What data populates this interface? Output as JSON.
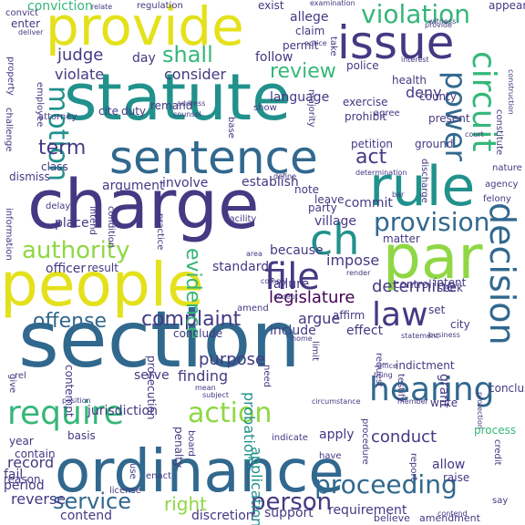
{
  "palette": {
    "yellow": "#e4e11b",
    "lime": "#8fd744",
    "green": "#35b779",
    "teal": "#21918c",
    "blue": "#31688e",
    "indigo": "#443983",
    "purple": "#440154"
  },
  "words": [
    {
      "text": "statute",
      "color": "teal"
    },
    {
      "text": "section",
      "color": "blue"
    },
    {
      "text": "charge",
      "color": "indigo"
    },
    {
      "text": "ordinance",
      "color": "blue"
    },
    {
      "text": "people",
      "color": "yellow"
    },
    {
      "text": "par",
      "color": "lime"
    },
    {
      "text": "provide",
      "color": "yellow"
    },
    {
      "text": "rule",
      "color": "teal"
    },
    {
      "text": "sentence",
      "color": "blue"
    },
    {
      "text": "issue",
      "color": "indigo"
    },
    {
      "text": "ch",
      "color": "teal"
    },
    {
      "text": "file",
      "color": "indigo"
    },
    {
      "text": "law",
      "color": "indigo"
    },
    {
      "text": "decision",
      "color": "blue"
    },
    {
      "text": "circuit",
      "color": "green"
    },
    {
      "text": "power",
      "color": "blue"
    },
    {
      "text": "hearing",
      "color": "blue"
    },
    {
      "text": "require",
      "color": "green"
    },
    {
      "text": "action",
      "color": "lime"
    },
    {
      "text": "provision",
      "color": "blue"
    },
    {
      "text": "authority",
      "color": "lime"
    },
    {
      "text": "violation",
      "color": "green"
    },
    {
      "text": "motion",
      "color": "teal"
    },
    {
      "text": "proceeding",
      "color": "blue"
    },
    {
      "text": "service",
      "color": "blue"
    },
    {
      "text": "person",
      "color": "indigo"
    },
    {
      "text": "offense",
      "color": "blue"
    },
    {
      "text": "complaint",
      "color": "indigo"
    },
    {
      "text": "evidence",
      "color": "green"
    },
    {
      "text": "legislature",
      "color": "purple"
    },
    {
      "text": "review",
      "color": "green"
    },
    {
      "text": "term",
      "color": "indigo"
    },
    {
      "text": "act",
      "color": "indigo"
    },
    {
      "text": "shall",
      "color": "green"
    },
    {
      "text": "judge",
      "color": "indigo"
    },
    {
      "text": "violate",
      "color": "indigo"
    },
    {
      "text": "consider",
      "color": "indigo"
    },
    {
      "text": "right",
      "color": "lime"
    },
    {
      "text": "conduct",
      "color": "indigo"
    },
    {
      "text": "determine",
      "color": "indigo"
    },
    {
      "text": "purpose",
      "color": "indigo"
    },
    {
      "text": "finding",
      "color": "indigo"
    },
    {
      "text": "jurisdiction",
      "color": "indigo"
    },
    {
      "text": "probation",
      "color": "teal"
    },
    {
      "text": "application",
      "color": "teal"
    },
    {
      "text": "failure",
      "color": "indigo"
    },
    {
      "text": "impose",
      "color": "indigo"
    },
    {
      "text": "argue",
      "color": "indigo"
    },
    {
      "text": "record",
      "color": "indigo"
    },
    {
      "text": "reverse",
      "color": "indigo"
    },
    {
      "text": "discretion",
      "color": "indigo"
    },
    {
      "text": "contend",
      "color": "indigo"
    },
    {
      "text": "support",
      "color": "indigo"
    },
    {
      "text": "requirement",
      "color": "indigo"
    },
    {
      "text": "believe",
      "color": "indigo"
    },
    {
      "text": "amendment",
      "color": "indigo"
    },
    {
      "text": "deny",
      "color": "indigo"
    },
    {
      "text": "standard",
      "color": "indigo"
    },
    {
      "text": "argument",
      "color": "indigo"
    },
    {
      "text": "place",
      "color": "indigo"
    },
    {
      "text": "officer",
      "color": "indigo"
    },
    {
      "text": "result",
      "color": "indigo"
    },
    {
      "text": "allege",
      "color": "indigo"
    },
    {
      "text": "claim",
      "color": "indigo"
    },
    {
      "text": "permit",
      "color": "indigo"
    },
    {
      "text": "enter",
      "color": "indigo"
    },
    {
      "text": "conviction",
      "color": "green"
    },
    {
      "text": "regulation",
      "color": "indigo"
    },
    {
      "text": "county",
      "color": "indigo"
    },
    {
      "text": "city",
      "color": "indigo"
    },
    {
      "text": "seek",
      "color": "indigo"
    },
    {
      "text": "matter",
      "color": "indigo"
    },
    {
      "text": "process",
      "color": "green"
    },
    {
      "text": "year",
      "color": "indigo"
    },
    {
      "text": "contain",
      "color": "indigo"
    },
    {
      "text": "fail",
      "color": "indigo"
    },
    {
      "text": "period",
      "color": "indigo"
    },
    {
      "text": "allow",
      "color": "indigo"
    },
    {
      "text": "raise",
      "color": "indigo"
    },
    {
      "text": "affirm",
      "color": "indigo"
    },
    {
      "text": "include",
      "color": "indigo"
    },
    {
      "text": "effect",
      "color": "indigo"
    },
    {
      "text": "conclude",
      "color": "indigo"
    },
    {
      "text": "serve",
      "color": "indigo"
    },
    {
      "text": "follow",
      "color": "indigo"
    },
    {
      "text": "exist",
      "color": "indigo"
    },
    {
      "text": "take",
      "color": "indigo"
    },
    {
      "text": "day",
      "color": "indigo"
    },
    {
      "text": "duty",
      "color": "indigo"
    },
    {
      "text": "cite",
      "color": "indigo"
    },
    {
      "text": "establish",
      "color": "indigo"
    },
    {
      "text": "involve",
      "color": "indigo"
    },
    {
      "text": "class",
      "color": "indigo"
    },
    {
      "text": "dismiss",
      "color": "indigo"
    },
    {
      "text": "note",
      "color": "indigo"
    },
    {
      "text": "leave",
      "color": "indigo"
    },
    {
      "text": "party",
      "color": "indigo"
    },
    {
      "text": "commit",
      "color": "indigo"
    },
    {
      "text": "village",
      "color": "indigo"
    },
    {
      "text": "because",
      "color": "indigo"
    },
    {
      "text": "language",
      "color": "indigo"
    },
    {
      "text": "police",
      "color": "indigo"
    },
    {
      "text": "health",
      "color": "indigo"
    },
    {
      "text": "petition",
      "color": "indigo"
    },
    {
      "text": "ground",
      "color": "indigo"
    },
    {
      "text": "remand",
      "color": "indigo"
    },
    {
      "text": "base",
      "color": "indigo"
    },
    {
      "text": "control",
      "color": "indigo"
    },
    {
      "text": "intent",
      "color": "indigo"
    },
    {
      "text": "set",
      "color": "indigo"
    },
    {
      "text": "request",
      "color": "indigo"
    },
    {
      "text": "indictment",
      "color": "indigo"
    },
    {
      "text": "testify",
      "color": "indigo"
    },
    {
      "text": "grant",
      "color": "indigo"
    },
    {
      "text": "apply",
      "color": "indigo"
    },
    {
      "text": "basis",
      "color": "indigo"
    },
    {
      "text": "give",
      "color": "indigo"
    },
    {
      "text": "need",
      "color": "indigo"
    },
    {
      "text": "limit",
      "color": "indigo"
    },
    {
      "text": "constitute",
      "color": "indigo"
    },
    {
      "text": "present",
      "color": "indigo"
    },
    {
      "text": "prohibit",
      "color": "indigo"
    },
    {
      "text": "exercise",
      "color": "indigo"
    },
    {
      "text": "majority",
      "color": "indigo"
    },
    {
      "text": "show",
      "color": "indigo"
    },
    {
      "text": "appear",
      "color": "indigo"
    },
    {
      "text": "convict",
      "color": "indigo"
    },
    {
      "text": "deliver",
      "color": "indigo"
    },
    {
      "text": "employee",
      "color": "indigo"
    },
    {
      "text": "attorney",
      "color": "indigo"
    },
    {
      "text": "property",
      "color": "indigo"
    },
    {
      "text": "challenge",
      "color": "indigo"
    },
    {
      "text": "information",
      "color": "indigo"
    },
    {
      "text": "intend",
      "color": "indigo"
    },
    {
      "text": "delay",
      "color": "indigo"
    },
    {
      "text": "condition",
      "color": "indigo"
    },
    {
      "text": "practice",
      "color": "indigo"
    },
    {
      "text": "facility",
      "color": "indigo"
    },
    {
      "text": "contempt",
      "color": "indigo"
    },
    {
      "text": "prosecution",
      "color": "indigo"
    },
    {
      "text": "discharge",
      "color": "indigo"
    },
    {
      "text": "felony",
      "color": "indigo"
    },
    {
      "text": "agency",
      "color": "indigo"
    },
    {
      "text": "nature",
      "color": "indigo"
    },
    {
      "text": "determination",
      "color": "indigo"
    },
    {
      "text": "procedure",
      "color": "indigo"
    },
    {
      "text": "report",
      "color": "indigo"
    },
    {
      "text": "conclusion",
      "color": "indigo"
    },
    {
      "text": "credit",
      "color": "indigo"
    },
    {
      "text": "say",
      "color": "indigo"
    },
    {
      "text": "write",
      "color": "indigo"
    },
    {
      "text": "reason",
      "color": "indigo"
    },
    {
      "text": "indicate",
      "color": "indigo"
    },
    {
      "text": "have",
      "color": "indigo"
    },
    {
      "text": "use",
      "color": "indigo"
    },
    {
      "text": "enact",
      "color": "indigo"
    },
    {
      "text": "penalty",
      "color": "indigo"
    },
    {
      "text": "board",
      "color": "indigo"
    },
    {
      "text": "license",
      "color": "indigo"
    },
    {
      "text": "define",
      "color": "indigo"
    },
    {
      "text": "examination",
      "color": "indigo"
    },
    {
      "text": "interest",
      "color": "indigo"
    },
    {
      "text": "witness",
      "color": "indigo"
    },
    {
      "text": "notice",
      "color": "indigo"
    },
    {
      "text": "relate",
      "color": "indigo"
    },
    {
      "text": "bar",
      "color": "indigo"
    },
    {
      "text": "render",
      "color": "indigo"
    },
    {
      "text": "circumstance",
      "color": "indigo"
    },
    {
      "text": "member",
      "color": "indigo"
    },
    {
      "text": "office",
      "color": "indigo"
    },
    {
      "text": "statement",
      "color": "indigo"
    },
    {
      "text": "position",
      "color": "indigo"
    },
    {
      "text": "subject",
      "color": "indigo"
    },
    {
      "text": "mean",
      "color": "indigo"
    },
    {
      "text": "address",
      "color": "indigo"
    },
    {
      "text": "counsel",
      "color": "indigo"
    },
    {
      "text": "home",
      "color": "indigo"
    },
    {
      "text": "accept",
      "color": "indigo"
    },
    {
      "text": "comply",
      "color": "indigo"
    },
    {
      "text": "area",
      "color": "indigo"
    },
    {
      "text": "amend",
      "color": "indigo"
    },
    {
      "text": "agree",
      "color": "indigo"
    },
    {
      "text": "court",
      "color": "indigo"
    },
    {
      "text": "rel",
      "color": "indigo"
    },
    {
      "text": "bring",
      "color": "indigo"
    },
    {
      "text": "contend",
      "color": "indigo"
    },
    {
      "text": "construction",
      "color": "indigo"
    },
    {
      "text": "business",
      "color": "indigo"
    },
    {
      "text": "protection",
      "color": "indigo"
    },
    {
      "text": "provide",
      "color": "indigo"
    }
  ]
}
